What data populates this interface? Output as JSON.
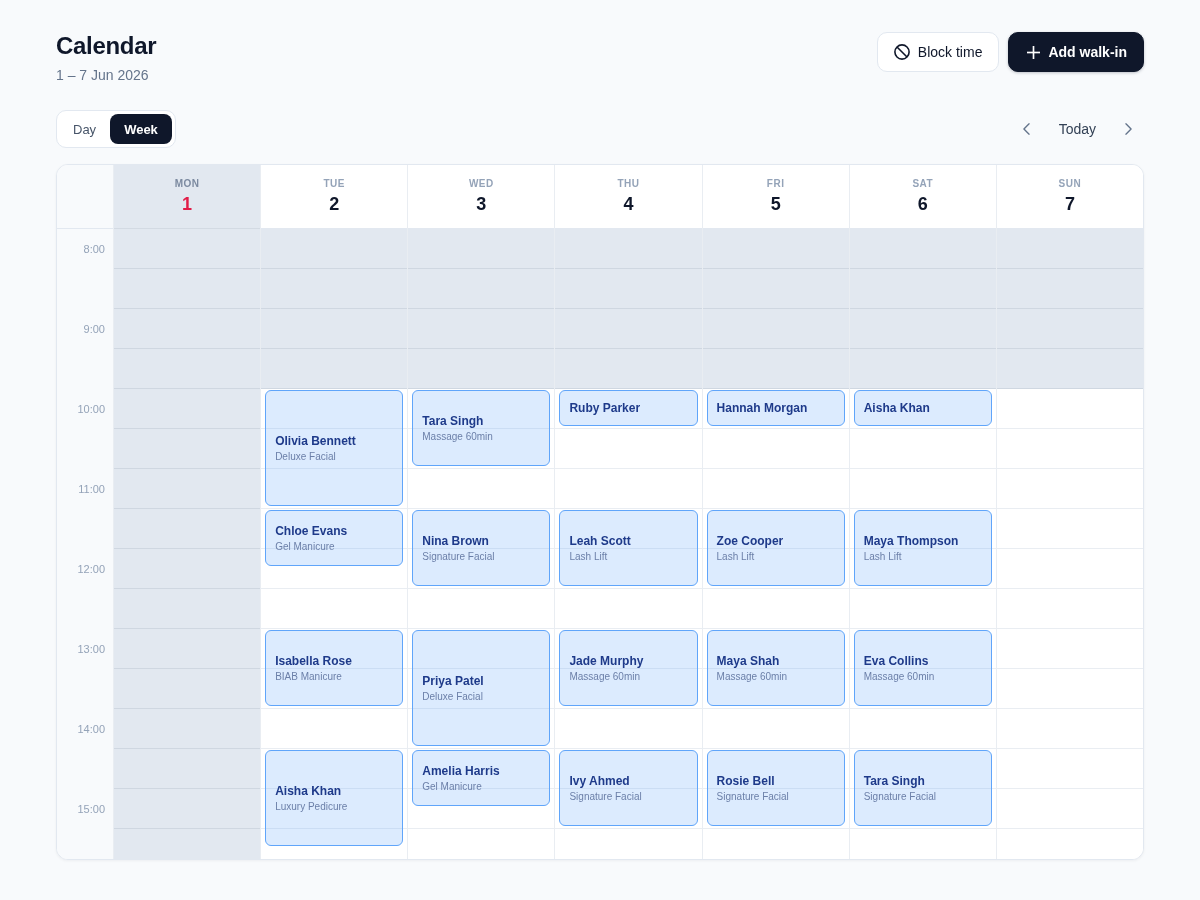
{
  "header": {
    "title": "Calendar",
    "date_range": "1 – 7 Jun 2026"
  },
  "actions": [
    {
      "kind": "block",
      "label": "Block time"
    },
    {
      "kind": "add",
      "label": "Add walk-in"
    }
  ],
  "views": [
    {
      "label": "Day",
      "selected": false
    },
    {
      "label": "Week",
      "selected": true
    }
  ],
  "navigation": {
    "today_label": "Today"
  },
  "hours": [
    "8:00",
    "9:00",
    "10:00",
    "11:00",
    "12:00",
    "13:00",
    "14:00",
    "15:00"
  ],
  "days": [
    {
      "weekday": "MON",
      "date": "1",
      "today": true,
      "closed": true,
      "slots": [
        {
          "closed": true
        },
        {
          "closed": true
        },
        {
          "closed": true
        },
        {
          "closed": true
        },
        {
          "closed": true
        },
        {
          "closed": true
        },
        {
          "closed": true
        },
        {
          "closed": true
        },
        {
          "closed": true
        },
        {
          "closed": true
        },
        {
          "closed": true
        },
        {
          "closed": true
        },
        {
          "closed": true
        },
        {
          "closed": true
        },
        {
          "closed": true
        }
      ]
    },
    {
      "weekday": "TUE",
      "date": "2",
      "today": false,
      "closed": false,
      "slots": [
        {
          "closed": true
        },
        {
          "closed": true
        },
        {
          "closed": true
        },
        {
          "closed": true
        },
        {
          "closed": false,
          "appointment": {
            "kind": "hourhalf",
            "client": "Olivia Bennett",
            "service": "Deluxe Facial"
          }
        },
        {
          "closed": false
        },
        {
          "closed": false
        },
        {
          "closed": false,
          "appointment": {
            "kind": "threequarter",
            "client": "Chloe Evans",
            "service": "Gel Manicure"
          }
        },
        {
          "closed": false
        },
        {
          "closed": false
        },
        {
          "closed": false,
          "appointment": {
            "kind": "hour",
            "client": "Isabella Rose",
            "service": "BIAB Manicure"
          }
        },
        {
          "closed": false
        },
        {
          "closed": false
        },
        {
          "closed": false,
          "appointment": {
            "kind": "hourquarter",
            "client": "Aisha Khan",
            "service": "Luxury Pedicure"
          }
        },
        {
          "closed": false
        }
      ]
    },
    {
      "weekday": "WED",
      "date": "3",
      "today": false,
      "closed": false,
      "slots": [
        {
          "closed": true
        },
        {
          "closed": true
        },
        {
          "closed": true
        },
        {
          "closed": true
        },
        {
          "closed": false,
          "appointment": {
            "kind": "hour",
            "client": "Tara Singh",
            "service": "Massage 60min"
          }
        },
        {
          "closed": false
        },
        {
          "closed": false
        },
        {
          "closed": false,
          "appointment": {
            "kind": "hour",
            "client": "Nina Brown",
            "service": "Signature Facial"
          }
        },
        {
          "closed": false
        },
        {
          "closed": false
        },
        {
          "closed": false,
          "appointment": {
            "kind": "hourhalf",
            "client": "Priya Patel",
            "service": "Deluxe Facial"
          }
        },
        {
          "closed": false
        },
        {
          "closed": false
        },
        {
          "closed": false,
          "appointment": {
            "kind": "threequarter",
            "client": "Amelia Harris",
            "service": "Gel Manicure"
          }
        },
        {
          "closed": false
        }
      ]
    },
    {
      "weekday": "THU",
      "date": "4",
      "today": false,
      "closed": false,
      "slots": [
        {
          "closed": true
        },
        {
          "closed": true
        },
        {
          "closed": true
        },
        {
          "closed": true
        },
        {
          "closed": false,
          "appointment": {
            "kind": "half",
            "client": "Ruby Parker"
          }
        },
        {
          "closed": false
        },
        {
          "closed": false
        },
        {
          "closed": false,
          "appointment": {
            "kind": "hour",
            "client": "Leah Scott",
            "service": "Lash Lift"
          }
        },
        {
          "closed": false
        },
        {
          "closed": false
        },
        {
          "closed": false,
          "appointment": {
            "kind": "hour",
            "client": "Jade Murphy",
            "service": "Massage 60min"
          }
        },
        {
          "closed": false
        },
        {
          "closed": false
        },
        {
          "closed": false,
          "appointment": {
            "kind": "hour",
            "client": "Ivy Ahmed",
            "service": "Signature Facial"
          }
        },
        {
          "closed": false
        }
      ]
    },
    {
      "weekday": "FRI",
      "date": "5",
      "today": false,
      "closed": false,
      "slots": [
        {
          "closed": true
        },
        {
          "closed": true
        },
        {
          "closed": true
        },
        {
          "closed": true
        },
        {
          "closed": false,
          "appointment": {
            "kind": "half",
            "client": "Hannah Morgan"
          }
        },
        {
          "closed": false
        },
        {
          "closed": false
        },
        {
          "closed": false,
          "appointment": {
            "kind": "hour",
            "client": "Zoe Cooper",
            "service": "Lash Lift"
          }
        },
        {
          "closed": false
        },
        {
          "closed": false
        },
        {
          "closed": false,
          "appointment": {
            "kind": "hour",
            "client": "Maya Shah",
            "service": "Massage 60min"
          }
        },
        {
          "closed": false
        },
        {
          "closed": false
        },
        {
          "closed": false,
          "appointment": {
            "kind": "hour",
            "client": "Rosie Bell",
            "service": "Signature Facial"
          }
        },
        {
          "closed": false
        }
      ]
    },
    {
      "weekday": "SAT",
      "date": "6",
      "today": false,
      "closed": false,
      "slots": [
        {
          "closed": true
        },
        {
          "closed": true
        },
        {
          "closed": true
        },
        {
          "closed": true
        },
        {
          "closed": false,
          "appointment": {
            "kind": "half",
            "client": "Aisha Khan"
          }
        },
        {
          "closed": false
        },
        {
          "closed": false
        },
        {
          "closed": false,
          "appointment": {
            "kind": "hour",
            "client": "Maya Thompson",
            "service": "Lash Lift"
          }
        },
        {
          "closed": false
        },
        {
          "closed": false
        },
        {
          "closed": false,
          "appointment": {
            "kind": "hour",
            "client": "Eva Collins",
            "service": "Massage 60min"
          }
        },
        {
          "closed": false
        },
        {
          "closed": false
        },
        {
          "closed": false,
          "appointment": {
            "kind": "hour",
            "client": "Tara Singh",
            "service": "Signature Facial"
          }
        },
        {
          "closed": false
        }
      ]
    },
    {
      "weekday": "SUN",
      "date": "7",
      "today": false,
      "closed": false,
      "slots": [
        {
          "closed": true
        },
        {
          "closed": true
        },
        {
          "closed": true
        },
        {
          "closed": true
        },
        {
          "closed": false
        },
        {
          "closed": false
        },
        {
          "closed": false
        },
        {
          "closed": false
        },
        {
          "closed": false
        },
        {
          "closed": false
        },
        {
          "closed": false
        },
        {
          "closed": false
        },
        {
          "closed": false
        },
        {
          "closed": false
        },
        {
          "closed": false
        }
      ]
    }
  ]
}
